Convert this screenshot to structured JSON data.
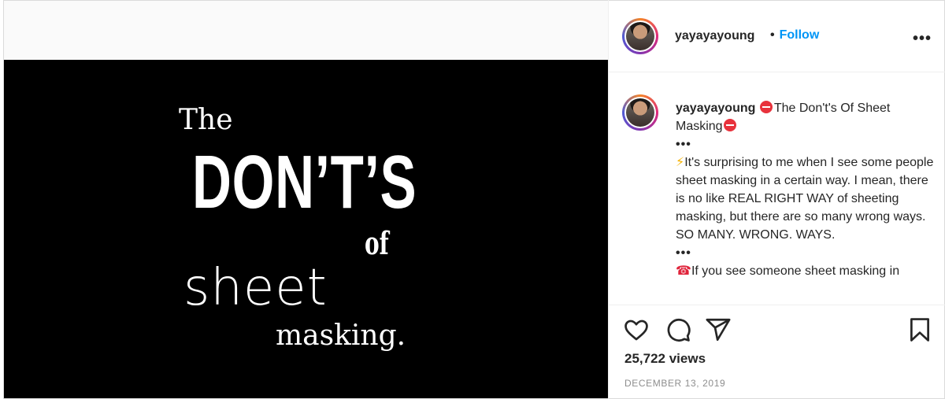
{
  "media": {
    "line1": "The",
    "line2": "DON’T’S",
    "line3": "of",
    "line4": "sheet",
    "line5": "masking."
  },
  "header": {
    "username": "yayayayoung",
    "separator": "•",
    "follow_label": "Follow",
    "more_label": "•••"
  },
  "caption": {
    "username": "yayayayoung",
    "title_part": "The Don't's Of Sheet Masking",
    "dots1": "•••",
    "para1_emoji": "⚡",
    "para1": "It's surprising to me when I see some people sheet masking in a certain way. I mean, there is no like REAL RIGHT WAY of sheeting masking, but there are so many wrong ways. SO MANY. WRONG. WAYS.",
    "dots2": "•••",
    "para2_emoji": "☎",
    "para2": "If you see someone sheet masking in"
  },
  "stats": {
    "views": "25,722 views",
    "date": "DECEMBER 13, 2019"
  },
  "colors": {
    "follow": "#0095f6",
    "border": "#dbdbdb",
    "muted": "#8e8e8e",
    "stop_sign": "#e8323c"
  },
  "icons": [
    "heart-icon",
    "comment-icon",
    "share-icon",
    "bookmark-icon",
    "more-icon"
  ]
}
